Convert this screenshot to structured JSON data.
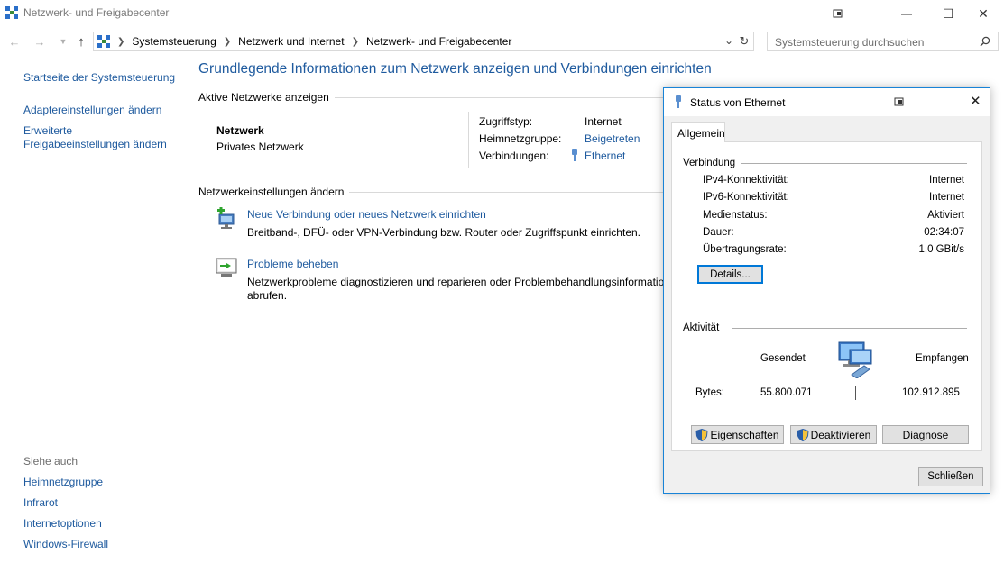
{
  "window": {
    "title": "Netzwerk- und Freigabecenter",
    "min_glyph": "—",
    "max_glyph": "☐",
    "close_glyph": "✕"
  },
  "address": {
    "crumbs": [
      "Systemsteuerung",
      "Netzwerk und Internet",
      "Netzwerk- und Freigabecenter"
    ],
    "search_placeholder": "Systemsteuerung durchsuchen"
  },
  "leftnav": {
    "items": [
      "Startseite der Systemsteuerung",
      "Adaptereinstellungen ändern",
      "Erweiterte Freigabeeinstellungen ändern"
    ],
    "see_also_label": "Siehe auch",
    "see_also": [
      "Heimnetzgruppe",
      "Infrarot",
      "Internetoptionen",
      "Windows-Firewall"
    ]
  },
  "main": {
    "title": "Grundlegende Informationen zum Netzwerk anzeigen und Verbindungen einrichten",
    "active_label": "Aktive Netzwerke anzeigen",
    "network_name": "Netzwerk",
    "network_type": "Privates Netzwerk",
    "access_label": "Zugriffstyp:",
    "access_value": "Internet",
    "homegroup_label": "Heimnetzgruppe:",
    "homegroup_value": "Beigetreten",
    "connections_label": "Verbindungen:",
    "connections_value": "Ethernet",
    "settings_label": "Netzwerkeinstellungen ändern",
    "new_conn_title": "Neue Verbindung oder neues Netzwerk einrichten",
    "new_conn_desc": "Breitband-, DFÜ- oder VPN-Verbindung bzw. Router oder Zugriffspunkt einrichten.",
    "troubleshoot_title": "Probleme beheben",
    "troubleshoot_desc_1": "Netzwerkprobleme diagnostizieren und reparieren oder Problembehandlungsinformationen",
    "troubleshoot_desc_2": "abrufen."
  },
  "dialog": {
    "title": "Status von Ethernet",
    "tab": "Allgemein",
    "connection_label": "Verbindung",
    "rows": [
      {
        "label": "IPv4-Konnektivität:",
        "value": "Internet"
      },
      {
        "label": "IPv6-Konnektivität:",
        "value": "Internet"
      },
      {
        "label": "Medienstatus:",
        "value": "Aktiviert"
      },
      {
        "label": "Dauer:",
        "value": "02:34:07"
      },
      {
        "label": "Übertragungsrate:",
        "value": "1,0 GBit/s"
      }
    ],
    "details_button": "Details...",
    "activity_label": "Aktivität",
    "sent_label": "Gesendet",
    "received_label": "Empfangen",
    "bytes_label": "Bytes:",
    "bytes_sent": "55.800.071",
    "bytes_received": "102.912.895",
    "properties_button": "Eigenschaften",
    "disable_button": "Deaktivieren",
    "diagnose_button": "Diagnose",
    "close_button": "Schließen"
  },
  "colors": {
    "link": "#1e5a9e",
    "dialog_border": "#1883d7",
    "focus": "#0078d7"
  }
}
